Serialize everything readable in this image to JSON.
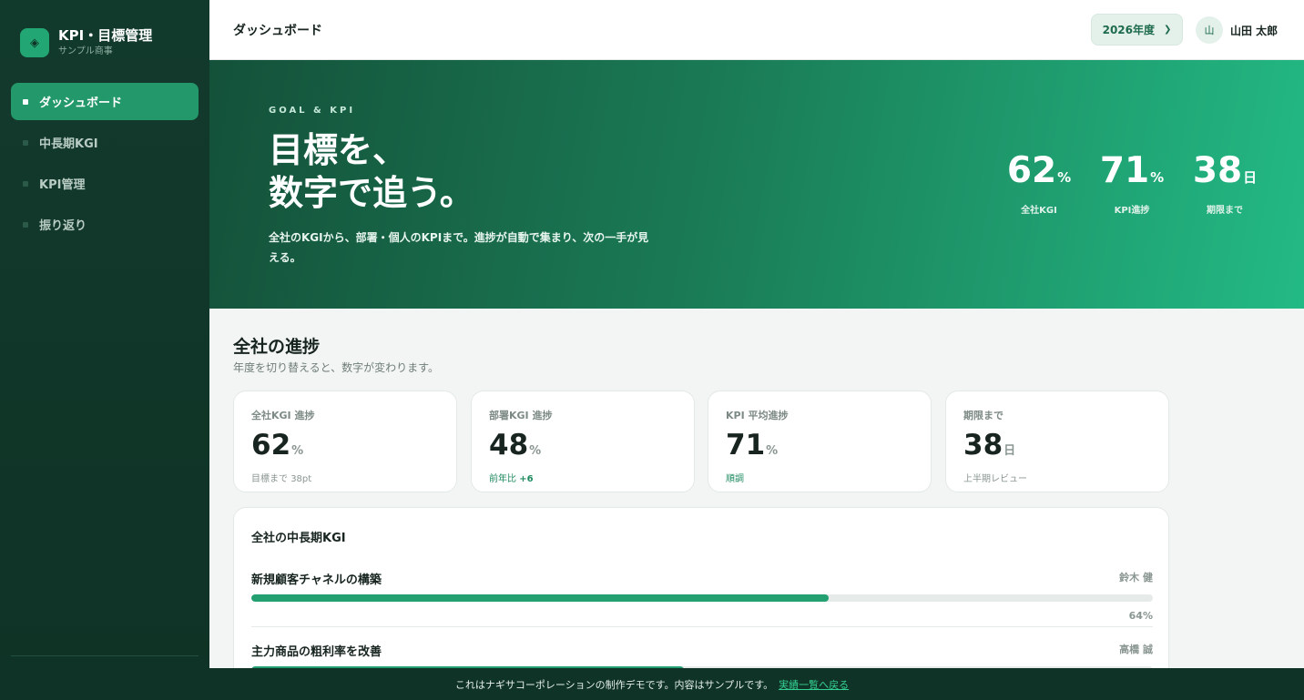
{
  "brand": {
    "logo_icon": "◈",
    "title": "KPI・目標管理",
    "subtitle": "サンプル商事"
  },
  "nav": {
    "items": [
      {
        "label": "ダッシュボード",
        "active": true
      },
      {
        "label": "中長期KGI",
        "active": false
      },
      {
        "label": "KPI管理",
        "active": false
      },
      {
        "label": "振り返り",
        "active": false
      }
    ]
  },
  "header": {
    "title": "ダッシュボード",
    "year_select": "2026年度",
    "chevron_icon": "chevron-down-icon",
    "avatar_initial": "山",
    "user_name": "山田 太郎"
  },
  "hero": {
    "eyebrow": "GOAL & KPI",
    "title_line1": "目標を、",
    "title_line2": "数字で追う。",
    "description": "全社のKGIから、部署・個人のKPIまで。進捗が自動で集まり、次の一手が見える。",
    "stats": [
      {
        "value": "62",
        "unit": "%",
        "label": "全社KGI"
      },
      {
        "value": "71",
        "unit": "%",
        "label": "KPI進捗"
      },
      {
        "value": "38",
        "unit": "日",
        "label": "期限まで"
      }
    ]
  },
  "overview": {
    "title": "全社の進捗",
    "subtitle": "年度を切り替えると、数字が変わります。",
    "cards": [
      {
        "label": "全社KGI 進捗",
        "value": "62",
        "unit": "%",
        "note_prefix": "目標まで",
        "note_value": "38pt"
      },
      {
        "label": "部署KGI 進捗",
        "value": "48",
        "unit": "%",
        "note_prefix": "前年比",
        "note_value": "+6"
      },
      {
        "label": "KPI 平均進捗",
        "value": "71",
        "unit": "%",
        "note_prefix": "順調",
        "note_value": ""
      },
      {
        "label": "期限まで",
        "value": "38",
        "unit": "日",
        "note_prefix": "上半期レビュー",
        "note_value": ""
      }
    ]
  },
  "kgi": {
    "title": "全社の中長期KGI",
    "items": [
      {
        "name": "新規顧客チャネルの構築",
        "owner": "鈴木 健",
        "progress": 64,
        "pct_label": "64%"
      },
      {
        "name": "主力商品の粗利率を改善",
        "owner": "高橋 誠",
        "progress": 48,
        "pct_label": ""
      }
    ]
  },
  "footer": {
    "text": "これはナギサコーポレーションの制作デモです。内容はサンプルです。",
    "link": "実績一覧へ戻る"
  },
  "colors": {
    "primary": "#23a072",
    "sidebar": "#123a2c",
    "hero_start": "#14513a",
    "hero_end": "#23ba85"
  }
}
